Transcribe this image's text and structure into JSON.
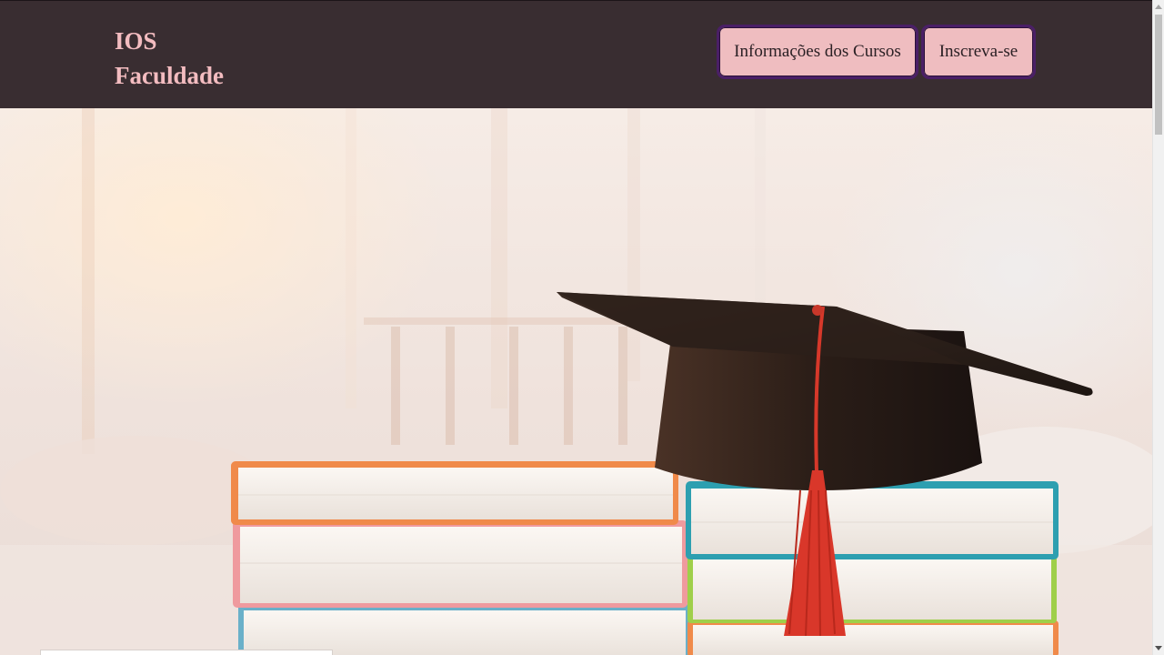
{
  "header": {
    "logo_line1": "IOS",
    "logo_line2": "Faculdade",
    "nav": [
      {
        "label": "Informações dos Cursos"
      },
      {
        "label": "Inscreva-se"
      }
    ]
  },
  "hero": {
    "image": "graduation-cap-on-books"
  },
  "colors": {
    "topbar": "#392d31",
    "logo": "#f3bcc0",
    "button_bg": "#efbdc0",
    "button_border": "#4a1f66"
  }
}
